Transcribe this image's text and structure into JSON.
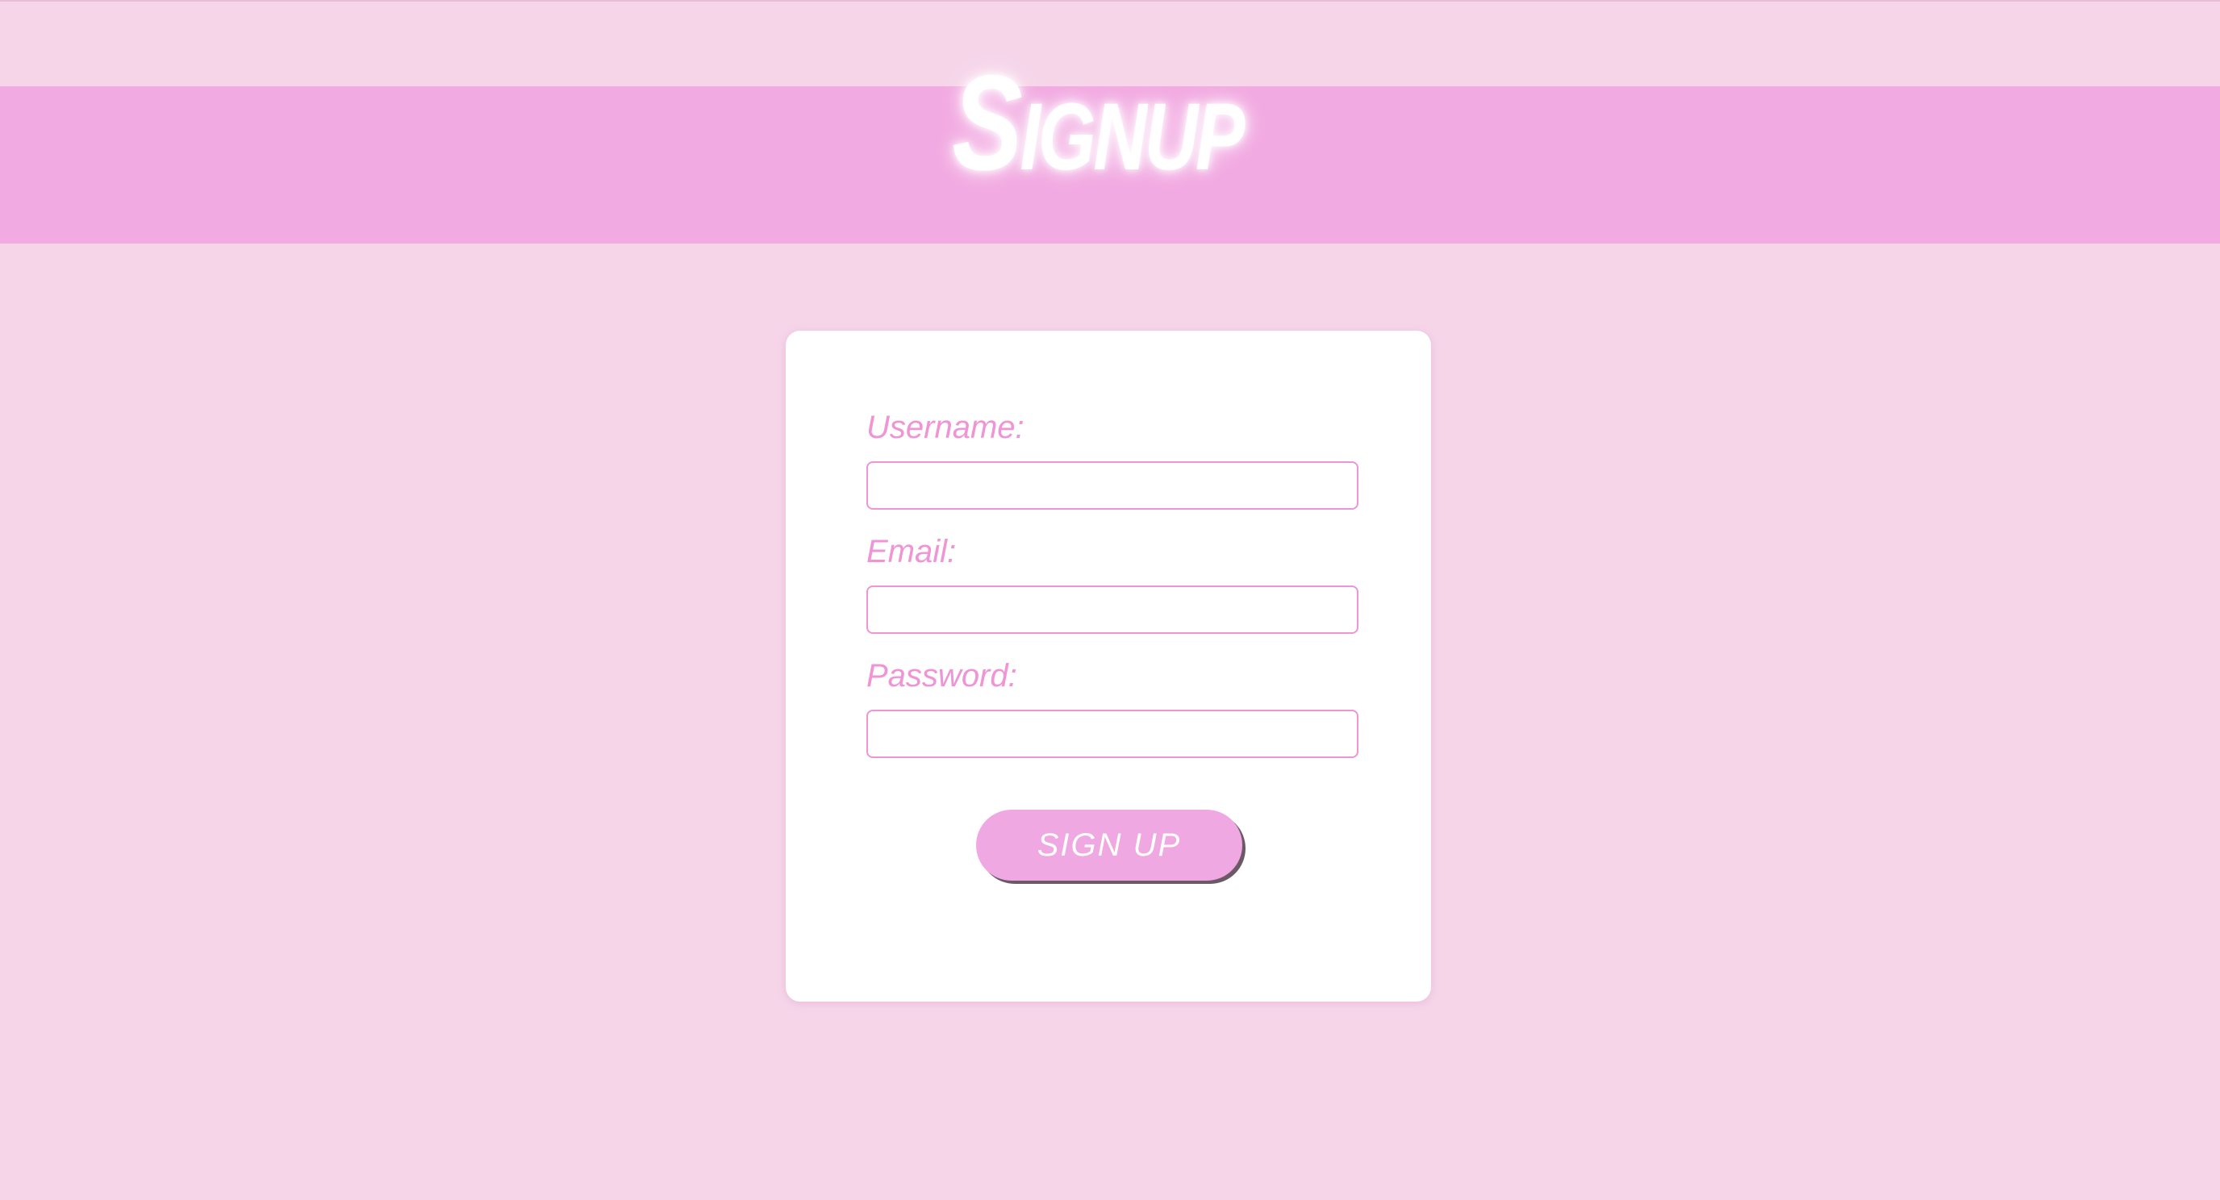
{
  "header": {
    "title": "Signup"
  },
  "form": {
    "username_label": "Username:",
    "username_value": "",
    "email_label": "Email:",
    "email_value": "",
    "password_label": "Password:",
    "password_value": "",
    "submit_label": "SIGN UP"
  },
  "colors": {
    "page_background": "#f6d5e9",
    "header_band": "#f2aae2",
    "accent": "#ef94d4",
    "card_background": "#ffffff",
    "button_background": "#f0a8e2"
  }
}
